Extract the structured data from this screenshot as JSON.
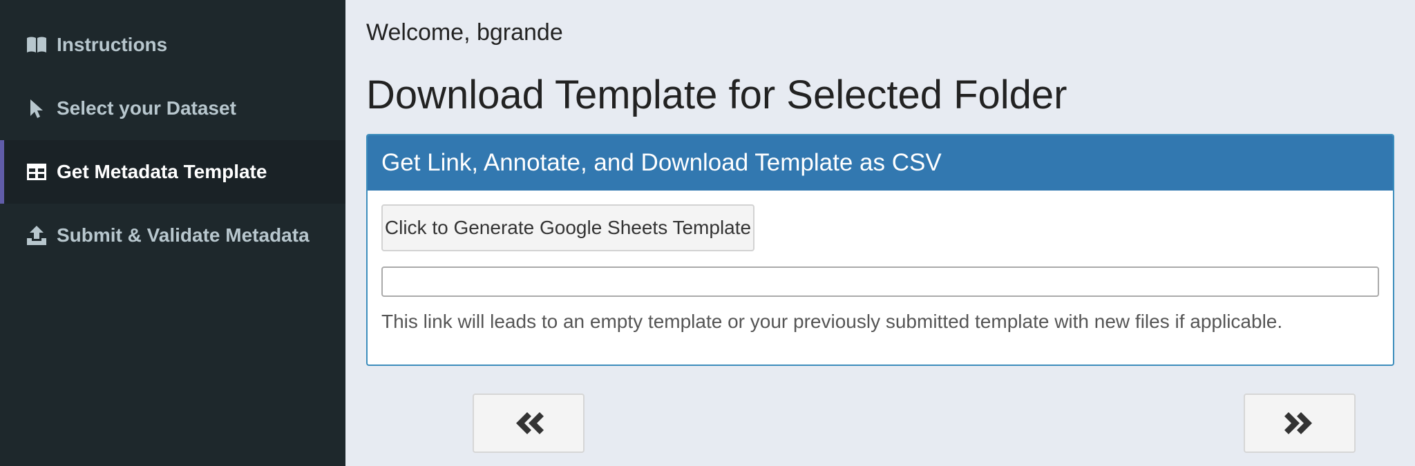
{
  "sidebar": {
    "items": [
      {
        "label": "Instructions",
        "icon": "book-open-icon",
        "active": false
      },
      {
        "label": "Select your Dataset",
        "icon": "mouse-pointer-icon",
        "active": false
      },
      {
        "label": "Get Metadata Template",
        "icon": "table-icon",
        "active": true
      },
      {
        "label": "Submit & Validate Metadata",
        "icon": "upload-icon",
        "active": false
      }
    ],
    "active_accent_color": "#605ca8",
    "background_color": "#1e282c"
  },
  "main": {
    "welcome": "Welcome, bgrande",
    "title": "Download Template for Selected Folder",
    "box": {
      "header": "Get Link, Annotate, and Download Template as CSV",
      "generate_button_label": "Click to Generate Google Sheets Template",
      "link_value": "",
      "help_text": "This link will leads to an empty template or your previously submitted template with new files if applicable.",
      "header_color": "#3278b0"
    },
    "prev_button_icon": "angle-double-left-icon",
    "next_button_icon": "angle-double-right-icon"
  }
}
